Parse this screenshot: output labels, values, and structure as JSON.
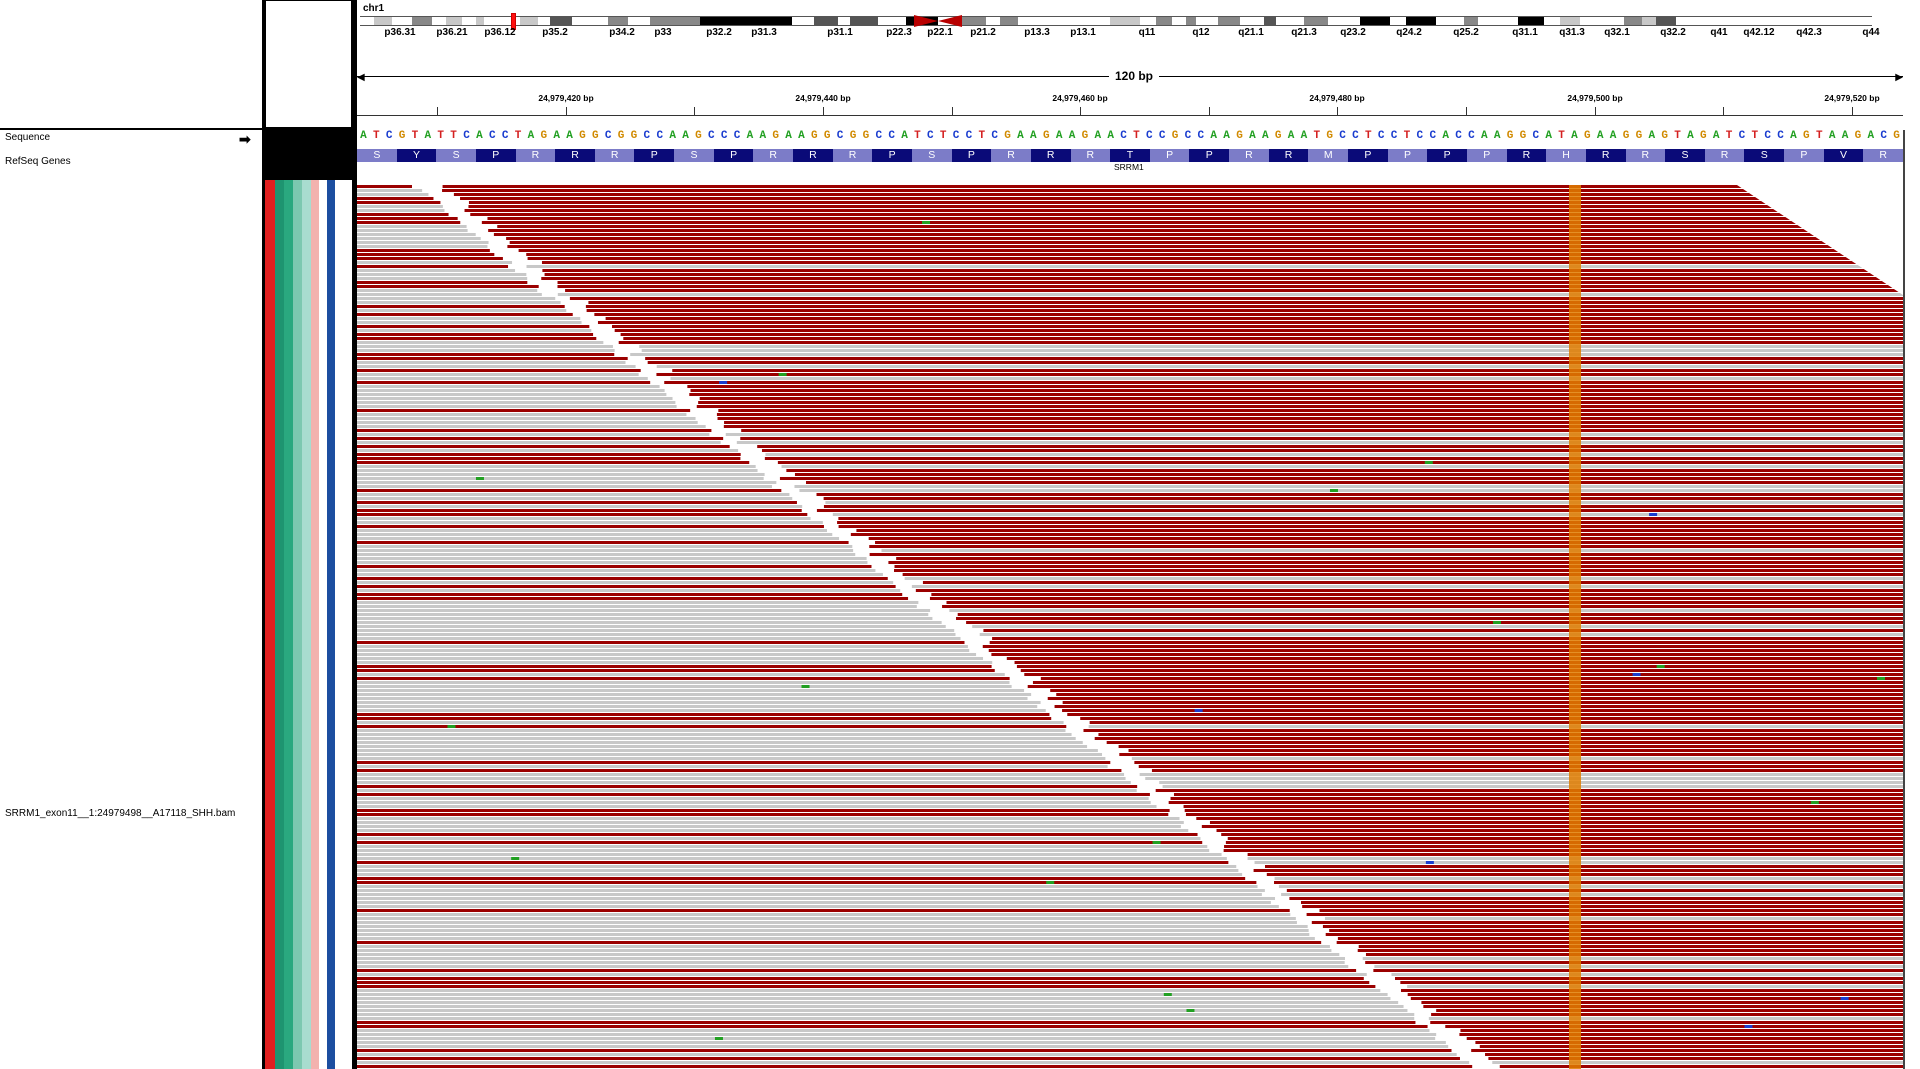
{
  "track_names": {
    "sequence": "Sequence",
    "refseq": "RefSeq Genes",
    "bam": "SRRM1_exon11__1:24979498__A17118_SHH.bam"
  },
  "ideogram": {
    "chromosome": "chr1",
    "band_labels": [
      "p36.31",
      "p36.21",
      "p36.12",
      "p35.2",
      "p34.2",
      "p33",
      "p32.2",
      "p31.3",
      "p31.1",
      "p22.3",
      "p22.1",
      "p21.2",
      "p13.3",
      "p13.1",
      "q11",
      "q12",
      "q21.1",
      "q21.3",
      "q23.2",
      "q24.2",
      "q25.2",
      "q31.1",
      "q31.3",
      "q32.1",
      "q32.2",
      "q41",
      "q42.12",
      "q42.3",
      "q44"
    ]
  },
  "ruler": {
    "span_label": "120 bp",
    "tick_labels": [
      "24,979,420 bp",
      "24,979,440 bp",
      "24,979,460 bp",
      "24,979,480 bp",
      "24,979,500 bp",
      "24,979,520 bp"
    ]
  },
  "sequence": "ATCGTATTCACCTAGAAGGCGGCCAAGCCCAAGAAGGCGGCCATCTCCTCGAAGAAGAACTCCGCCAAGAAGAATGCCTCCTCCACCAAGGCATAGAAGGAGTAGATCTCCAGTAAGACG",
  "amino_acids": [
    "S",
    "Y",
    "S",
    "P",
    "R",
    "R",
    "R",
    "P",
    "S",
    "P",
    "R",
    "R",
    "R",
    "P",
    "S",
    "P",
    "R",
    "R",
    "R",
    "T",
    "P",
    "P",
    "R",
    "R",
    "M",
    "P",
    "P",
    "P",
    "P",
    "R",
    "H",
    "R",
    "R",
    "S",
    "R",
    "S",
    "P",
    "V",
    "R"
  ],
  "gene_name": "SRRM1",
  "colors": {
    "base_A": "#22a022",
    "base_C": "#1a3ccf",
    "base_G": "#d18a00",
    "base_T": "#d42020",
    "read_gray": "#c8c8c8",
    "read_red": "#9b0000",
    "snp_orange": "#e07d00",
    "gene_navy": "#0a0a78"
  },
  "attribute_colors": [
    "#e02020",
    "#1e9470",
    "#2aa87f",
    "#7cc8b0",
    "#a8dccf",
    "#f3b2ae",
    "#ffffff",
    "#1c4ea0"
  ]
}
